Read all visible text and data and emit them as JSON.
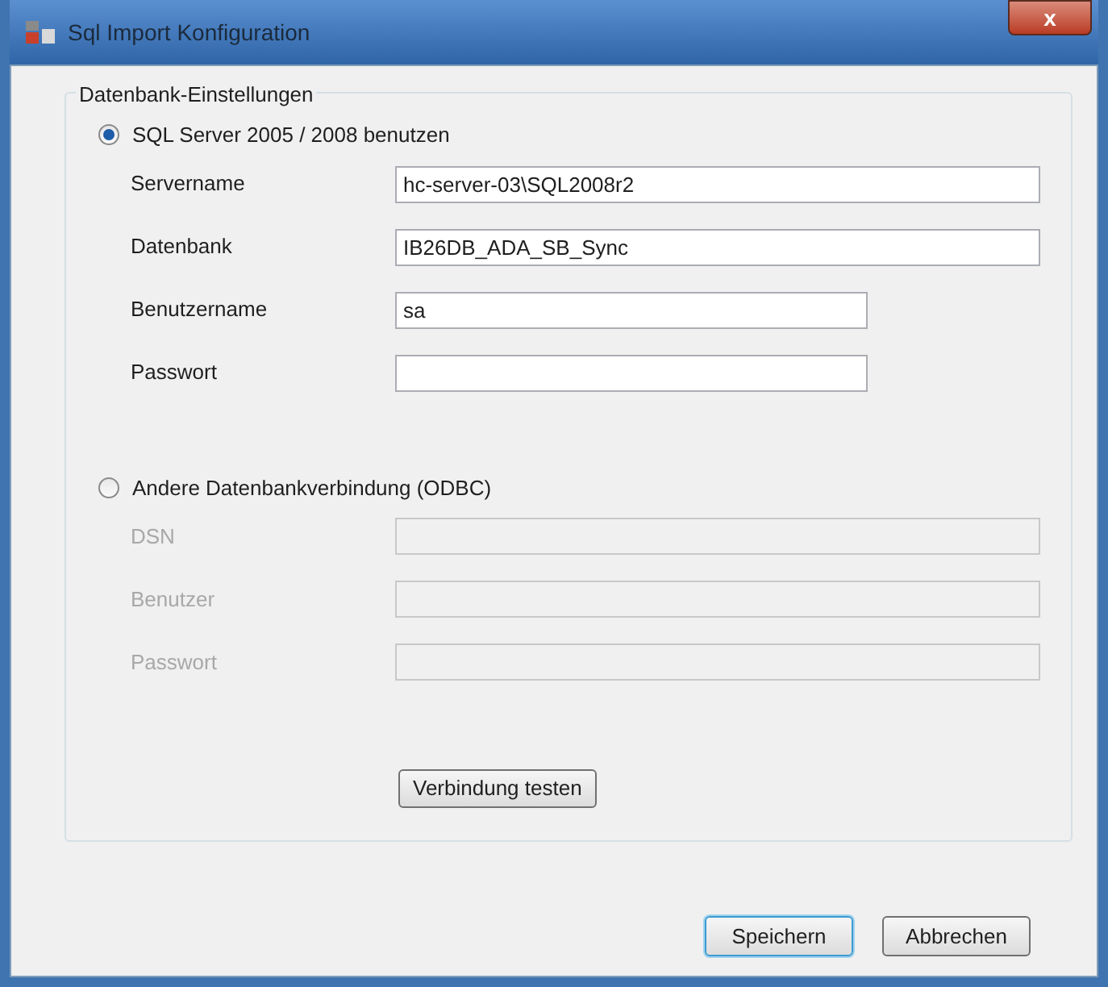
{
  "window": {
    "title": "Sql Import Konfiguration",
    "close": "x"
  },
  "group": {
    "title": "Datenbank-Einstellungen",
    "options": [
      {
        "label": "SQL Server 2005 / 2008 benutzen",
        "selected": true,
        "fields": [
          {
            "label": "Servername",
            "value": "hc-server-03\\SQL2008r2",
            "disabled": false
          },
          {
            "label": "Datenbank",
            "value": "IB26DB_ADA_SB_Sync",
            "disabled": false
          },
          {
            "label": "Benutzername",
            "value": "sa",
            "disabled": false
          },
          {
            "label": "Passwort",
            "disabled": false
          }
        ]
      },
      {
        "label": "Andere Datenbankverbindung (ODBC)",
        "selected": false,
        "fields": [
          {
            "label": "DSN",
            "disabled": true
          },
          {
            "label": "Benutzer",
            "disabled": true
          },
          {
            "label": "Passwort",
            "disabled": true
          }
        ]
      }
    ],
    "test_button": "Verbindung testen"
  },
  "buttons": [
    {
      "label": "Speichern",
      "default": true
    },
    {
      "label": "Abbrechen",
      "default": false
    }
  ]
}
